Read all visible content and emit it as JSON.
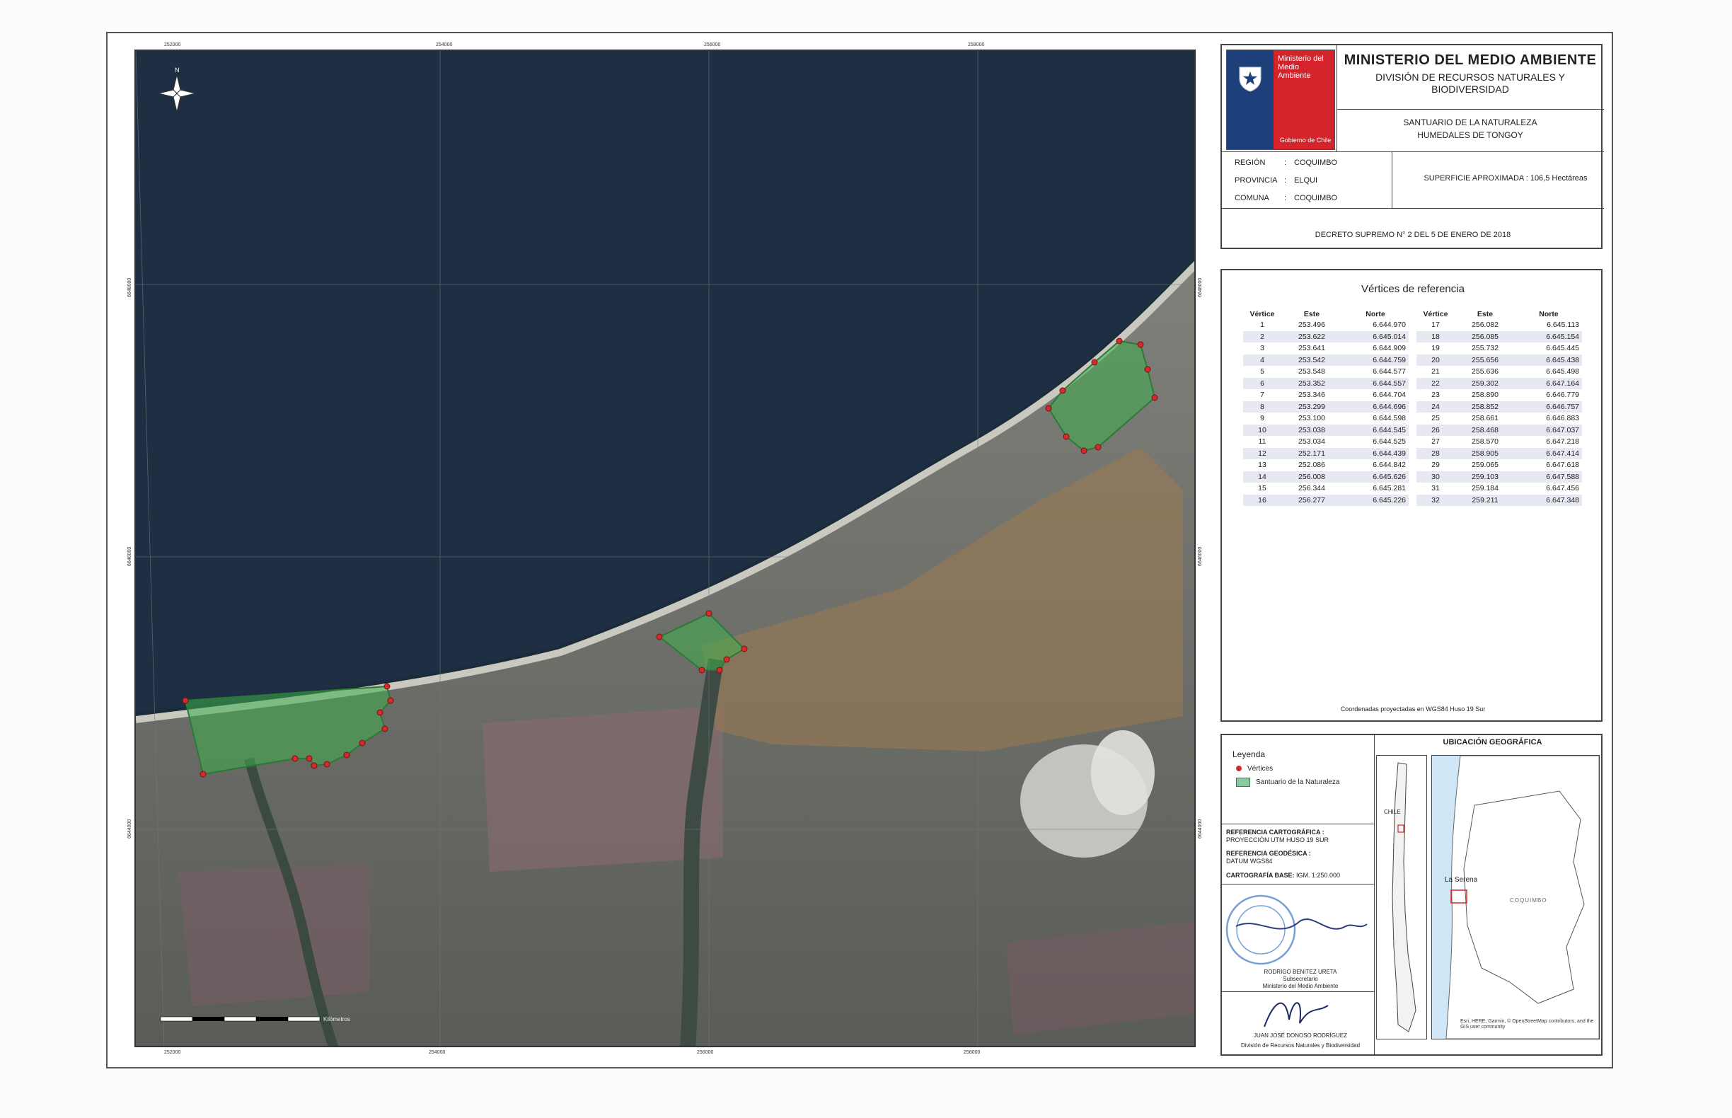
{
  "title_block": {
    "logo_text": [
      "Ministerio del",
      "Medio",
      "Ambiente"
    ],
    "logo_sub": "Gobierno de Chile",
    "ministry": "MINISTERIO DEL MEDIO AMBIENTE",
    "division": [
      "DIVISIÓN DE RECURSOS NATURALES Y",
      "BIODIVERSIDAD"
    ],
    "sanctuary": [
      "SANTUARIO DE LA NATURALEZA",
      "HUMEDALES DE TONGOY"
    ],
    "region_label": "REGIÓN",
    "region_value": "COQUIMBO",
    "provincia_label": "PROVINCIA",
    "provincia_value": "ELQUI",
    "comuna_label": "COMUNA",
    "comuna_value": "COQUIMBO",
    "superficie": "SUPERFICIE APROXIMADA : 106,5 Hectáreas",
    "decreto": "DECRETO SUPREMO  N° 2  DEL 5 DE ENERO DE 2018"
  },
  "vertices": {
    "title": "Vértices de referencia",
    "headers": [
      "Vértice",
      "Este",
      "Norte"
    ],
    "rows": [
      [
        "1",
        "253.496",
        "6.644.970"
      ],
      [
        "2",
        "253.622",
        "6.645.014"
      ],
      [
        "3",
        "253.641",
        "6.644.909"
      ],
      [
        "4",
        "253.542",
        "6.644.759"
      ],
      [
        "5",
        "253.548",
        "6.644.577"
      ],
      [
        "6",
        "253.352",
        "6.644.557"
      ],
      [
        "7",
        "253.346",
        "6.644.704"
      ],
      [
        "8",
        "253.299",
        "6.644.696"
      ],
      [
        "9",
        "253.100",
        "6.644.598"
      ],
      [
        "10",
        "253.038",
        "6.644.545"
      ],
      [
        "11",
        "253.034",
        "6.644.525"
      ],
      [
        "12",
        "252.171",
        "6.644.439"
      ],
      [
        "13",
        "252.086",
        "6.644.842"
      ],
      [
        "14",
        "256.008",
        "6.645.626"
      ],
      [
        "15",
        "256.344",
        "6.645.281"
      ],
      [
        "16",
        "256.277",
        "6.645.226"
      ],
      [
        "17",
        "256.082",
        "6.645.113"
      ],
      [
        "18",
        "256.085",
        "6.645.154"
      ],
      [
        "19",
        "255.732",
        "6.645.445"
      ],
      [
        "20",
        "255.656",
        "6.645.438"
      ],
      [
        "21",
        "255.636",
        "6.645.498"
      ],
      [
        "22",
        "259.302",
        "6.647.164"
      ],
      [
        "23",
        "258.890",
        "6.646.779"
      ],
      [
        "24",
        "258.852",
        "6.646.757"
      ],
      [
        "25",
        "258.661",
        "6.646.883"
      ],
      [
        "26",
        "258.468",
        "6.647.037"
      ],
      [
        "27",
        "258.570",
        "6.647.218"
      ],
      [
        "28",
        "258.905",
        "6.647.414"
      ],
      [
        "29",
        "259.065",
        "6.647.618"
      ],
      [
        "30",
        "259.103",
        "6.647.588"
      ],
      [
        "31",
        "259.184",
        "6.647.456"
      ],
      [
        "32",
        "259.211",
        "6.647.348"
      ]
    ],
    "note": "Coordenadas proyectadas en WGS84 Huso 19 Sur"
  },
  "legend": {
    "title": "Leyenda",
    "vertices_label": "Vértices",
    "sanctuary_label": "Santuario de la Naturaleza"
  },
  "references": {
    "cartografica_label": "REFERENCIA  CARTOGRÁFICA :",
    "cartografica_value": "PROYECCIÓN UTM HUSO 19 SUR",
    "geodesica_label": "REFERENCIA  GEODÉSICA :",
    "geodesica_value": "DATUM WGS84",
    "base_label": "CARTOGRAFÍA BASE:",
    "base_value": "IGM. 1:250.000"
  },
  "signatures": {
    "sig1_name": "RODRIGO BENITEZ URETA",
    "sig1_role": "Subsecretario",
    "sig1_org": "Ministerio del Medio Ambiente",
    "sig2_name": "JUAN JOSÉ DONOSO RODRÍGUEZ",
    "sig2_org": "División de Recursos Naturales y Biodiversidad"
  },
  "location": {
    "title": "UBICACIÓN GEOGRÁFICA",
    "country": "CHILE",
    "city": "La Serena",
    "region": "COQUIMBO",
    "credits": "Esri, HERE, Garmin, © OpenStreetMap contributors, and the GIS user community"
  },
  "map_grid": {
    "top": [
      "252000",
      "254000",
      "256000",
      "258000"
    ],
    "bottom": [
      "252000",
      "254000",
      "256000",
      "258000"
    ],
    "left": [
      "6648000",
      "6646000",
      "6644000"
    ],
    "right": [
      "6648000",
      "6646000",
      "6644000"
    ],
    "scale_label": "Kilómetros",
    "north_label": "N"
  },
  "colors": {
    "sea": "#1b2b3a",
    "sanctuary_fill": "#3fae4f",
    "vertex": "#d12c2c"
  }
}
